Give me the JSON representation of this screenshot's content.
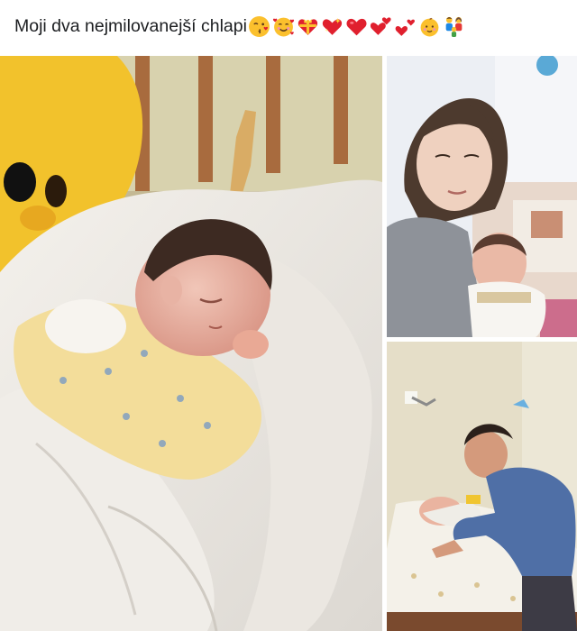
{
  "post": {
    "caption_text": "Moji dva nejmilovanejší chlapi",
    "caption_emojis": [
      "kissing-face-icon",
      "smiling-face-with-hearts-icon",
      "heart-with-ribbon-icon",
      "sparkling-heart-icon",
      "red-heart-icon",
      "two-hearts-icon",
      "two-hearts-icon",
      "baby-face-icon",
      "family-icon"
    ]
  },
  "photos": [
    {
      "subject": "sleeping newborn in crib"
    },
    {
      "subject": "mother holding newborn"
    },
    {
      "subject": "father with baby on changing table"
    }
  ],
  "colors": {
    "caption_text": "#1c1e21",
    "emoji_yellow": "#f7b500",
    "emoji_red": "#e0202e"
  }
}
